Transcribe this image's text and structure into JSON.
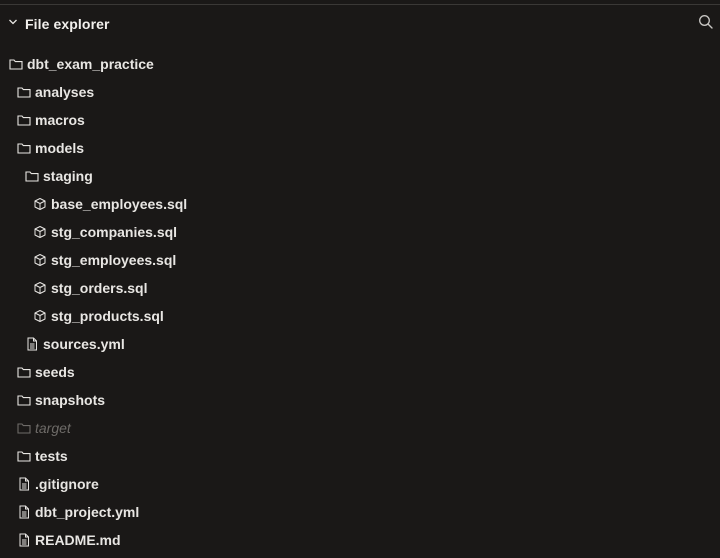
{
  "panel": {
    "title": "File explorer"
  },
  "icons": {
    "chevron": "chevron-down-icon",
    "search": "search-icon",
    "folder": "folder-icon",
    "model": "cube-icon",
    "file": "file-icon"
  },
  "colors": {
    "background": "#1a1817",
    "text": "#e8e6e3",
    "muted_text": "#6e6b68"
  },
  "tree": {
    "project": {
      "label": "dbt_exam_practice",
      "type": "folder"
    },
    "analyses": {
      "label": "analyses",
      "type": "folder"
    },
    "macros": {
      "label": "macros",
      "type": "folder"
    },
    "models": {
      "label": "models",
      "type": "folder"
    },
    "staging": {
      "label": "staging",
      "type": "folder"
    },
    "base_employees": {
      "label": "base_employees.sql",
      "type": "model"
    },
    "stg_companies": {
      "label": "stg_companies.sql",
      "type": "model"
    },
    "stg_employees": {
      "label": "stg_employees.sql",
      "type": "model"
    },
    "stg_orders": {
      "label": "stg_orders.sql",
      "type": "model"
    },
    "stg_products": {
      "label": "stg_products.sql",
      "type": "model"
    },
    "sources": {
      "label": "sources.yml",
      "type": "file"
    },
    "seeds": {
      "label": "seeds",
      "type": "folder"
    },
    "snapshots": {
      "label": "snapshots",
      "type": "folder"
    },
    "target": {
      "label": "target",
      "type": "folder",
      "ignored": true
    },
    "tests": {
      "label": "tests",
      "type": "folder"
    },
    "gitignore": {
      "label": ".gitignore",
      "type": "file"
    },
    "dbt_project": {
      "label": "dbt_project.yml",
      "type": "file"
    },
    "readme": {
      "label": "README.md",
      "type": "file"
    }
  }
}
